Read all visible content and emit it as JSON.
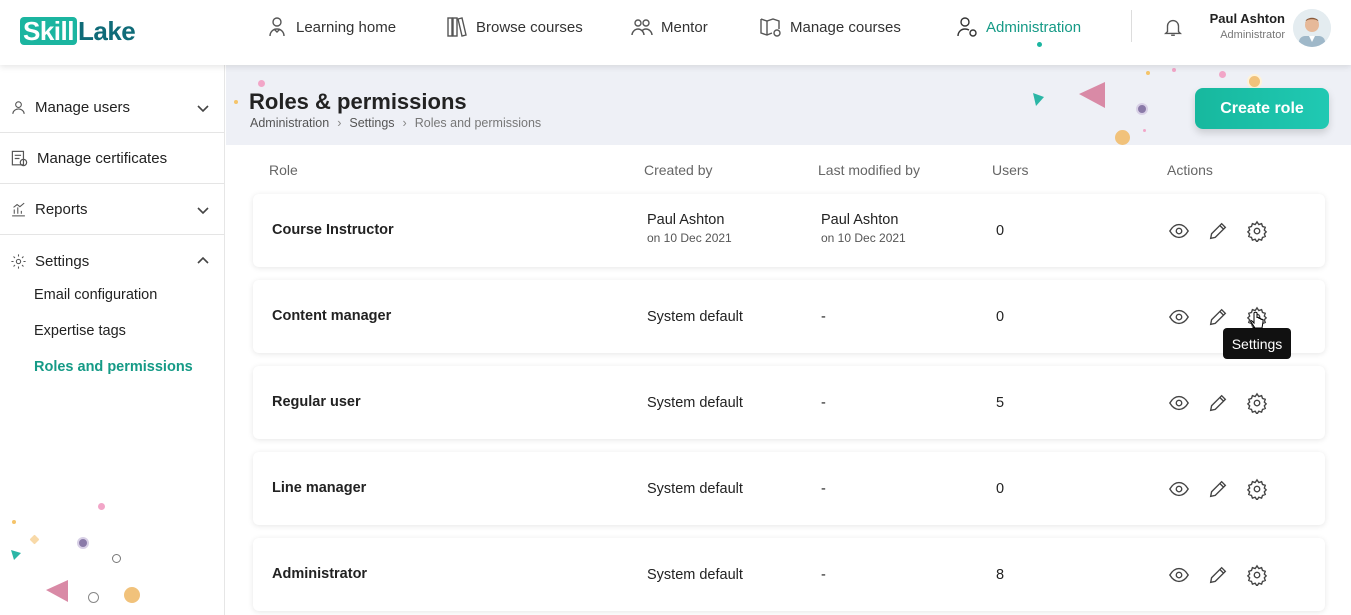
{
  "brand": {
    "part1": "Skill",
    "part2": "Lake"
  },
  "nav": {
    "learning_home": "Learning home",
    "browse_courses": "Browse courses",
    "mentor": "Mentor",
    "manage_courses": "Manage courses",
    "administration": "Administration"
  },
  "user": {
    "name": "Paul Ashton",
    "role": "Administrator"
  },
  "sidebar": {
    "manage_users": "Manage users",
    "manage_certificates": "Manage certificates",
    "reports": "Reports",
    "settings": "Settings",
    "sub_items": [
      "Email configuration",
      "Expertise tags",
      "Roles and permissions"
    ]
  },
  "page": {
    "title": "Roles & permissions",
    "breadcrumb": [
      "Administration",
      "Settings",
      "Roles and permissions"
    ],
    "create_button": "Create role"
  },
  "table": {
    "headers": [
      "Role",
      "Created by",
      "Last modified by",
      "Users",
      "Actions"
    ],
    "rows": [
      {
        "role": "Course Instructor",
        "created_by": "Paul Ashton",
        "created_on": "on 10 Dec 2021",
        "modified_by": "Paul Ashton",
        "modified_on": "on 10 Dec 2021",
        "users": "0"
      },
      {
        "role": "Content manager",
        "created_by": "System default",
        "created_on": "",
        "modified_by": "-",
        "modified_on": "",
        "users": "0"
      },
      {
        "role": "Regular user",
        "created_by": "System default",
        "created_on": "",
        "modified_by": "-",
        "modified_on": "",
        "users": "5"
      },
      {
        "role": "Line manager",
        "created_by": "System default",
        "created_on": "",
        "modified_by": "-",
        "modified_on": "",
        "users": "0"
      },
      {
        "role": "Administrator",
        "created_by": "System default",
        "created_on": "",
        "modified_by": "-",
        "modified_on": "",
        "users": "8"
      }
    ]
  },
  "tooltip": "Settings",
  "colors": {
    "accent": "#1bb5a0",
    "brand_dark": "#0f6b78"
  },
  "icons": [
    "eye-icon",
    "pencil-icon",
    "gear-icon"
  ]
}
